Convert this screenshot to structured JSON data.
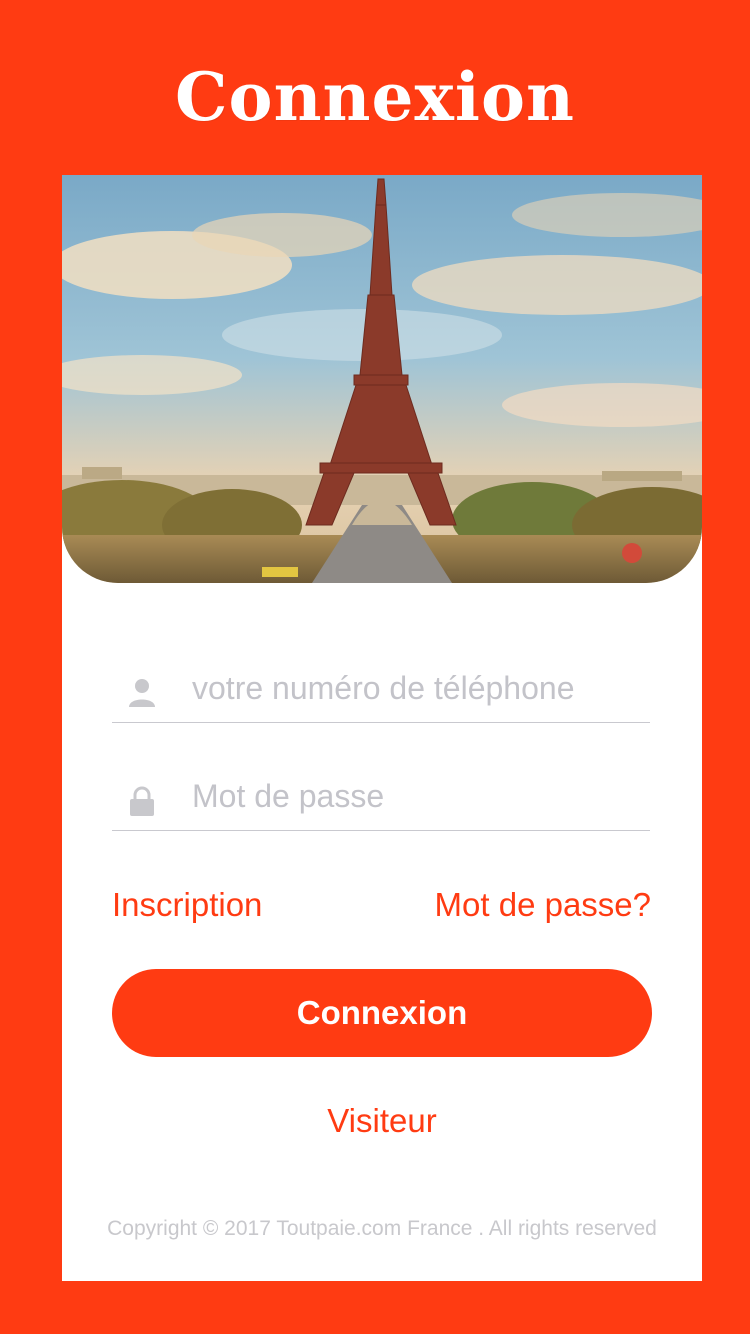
{
  "header": {
    "title": "Connexion"
  },
  "hero": {
    "image_icon": "eiffel-tower-photo"
  },
  "form": {
    "phone": {
      "placeholder": "votre numéro de téléphone",
      "value": "",
      "icon": "user-icon"
    },
    "password": {
      "placeholder": "Mot de passe",
      "value": "",
      "icon": "lock-icon"
    }
  },
  "links": {
    "register": "Inscription",
    "forgot": "Mot de passe?"
  },
  "login_button": {
    "label": "Connexion"
  },
  "visitor_link": {
    "label": "Visiteur"
  },
  "footer": {
    "copyright": "Copyright © 2017 Toutpaie.com France . All rights reserved"
  },
  "colors": {
    "brand": "#ff3b12",
    "card": "#ffffff",
    "placeholder": "#c3c3c9",
    "divider": "#c9c9cf",
    "copyright": "#c8c8cc"
  }
}
